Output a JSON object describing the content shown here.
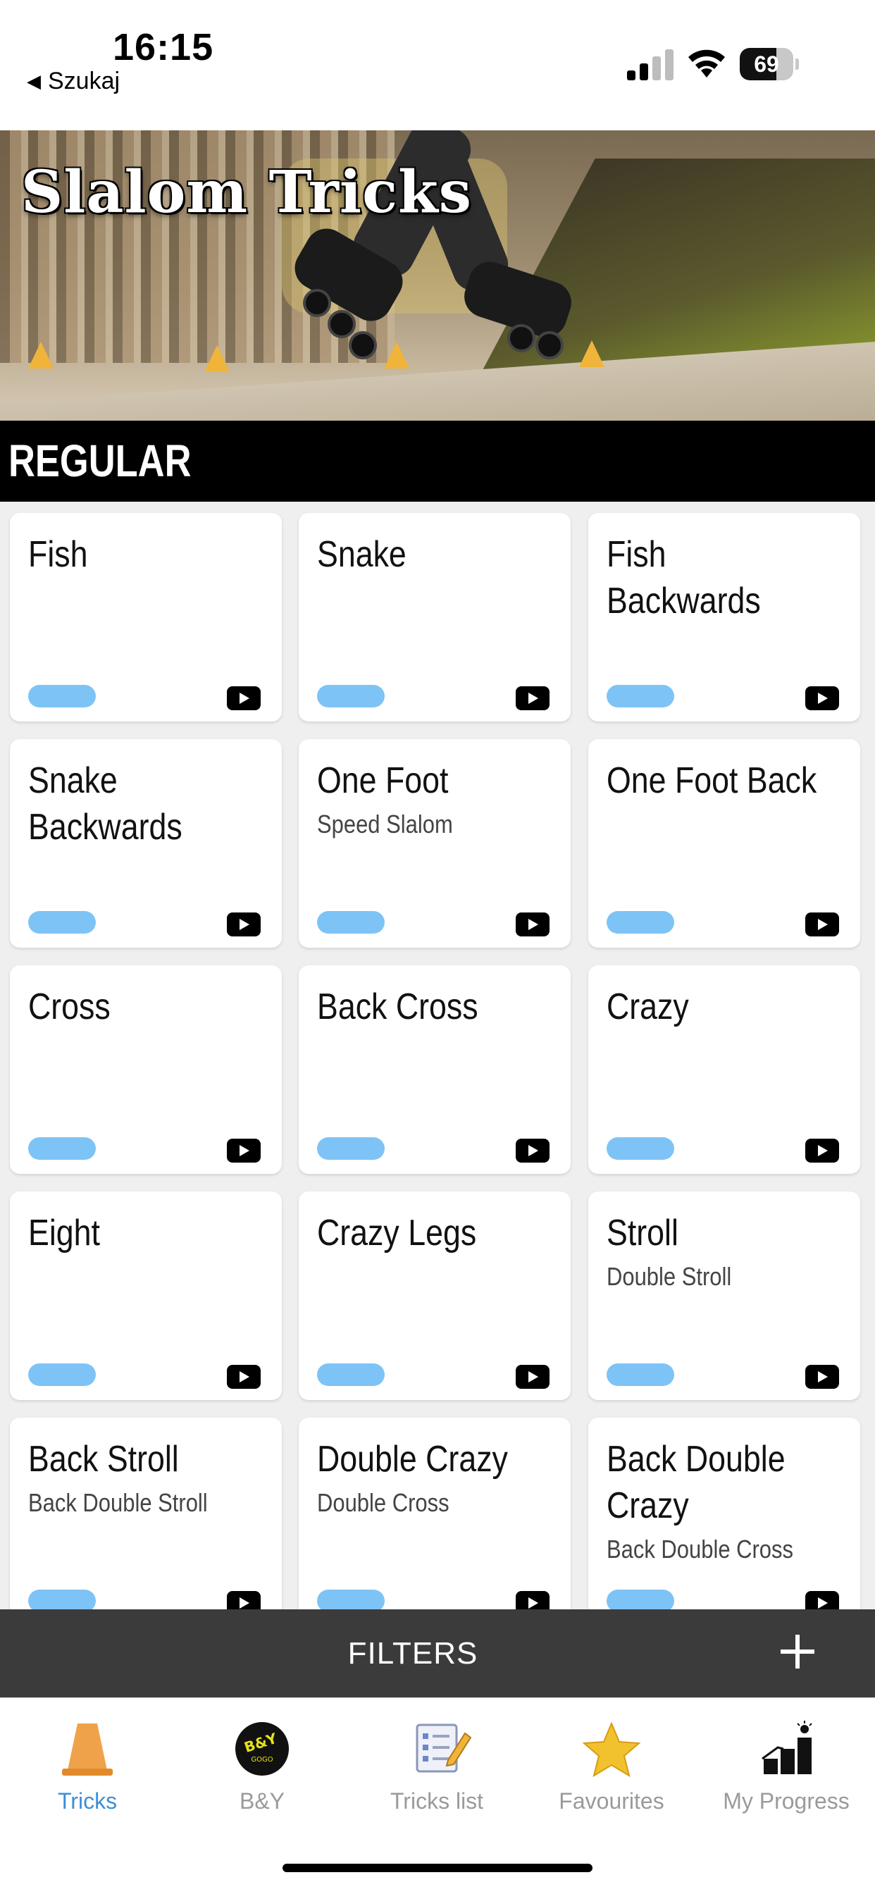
{
  "status_bar": {
    "time": "16:15",
    "back_label": "Szukaj",
    "battery_percent": "69",
    "battery_level": 0.69,
    "icons": [
      "signal-icon",
      "wifi-icon",
      "battery-icon"
    ]
  },
  "hero": {
    "title": "Slalom Tricks"
  },
  "section": {
    "title": "REGULAR"
  },
  "colors": {
    "progress": "#7ec3f5",
    "active_tab": "#3d8ed8",
    "inactive_tab": "#9a9a9a",
    "filters_bg": "#3b3b3b"
  },
  "tricks": [
    {
      "name": "Fish",
      "subtitle": ""
    },
    {
      "name": "Snake",
      "subtitle": ""
    },
    {
      "name": "Fish Backwards",
      "subtitle": ""
    },
    {
      "name": "Snake Backwards",
      "subtitle": ""
    },
    {
      "name": "One Foot",
      "subtitle": "Speed Slalom"
    },
    {
      "name": "One Foot Back",
      "subtitle": ""
    },
    {
      "name": "Cross",
      "subtitle": ""
    },
    {
      "name": "Back Cross",
      "subtitle": ""
    },
    {
      "name": "Crazy",
      "subtitle": ""
    },
    {
      "name": "Eight",
      "subtitle": ""
    },
    {
      "name": "Crazy Legs",
      "subtitle": ""
    },
    {
      "name": "Stroll",
      "subtitle": "Double Stroll"
    },
    {
      "name": "Back Stroll",
      "subtitle": "Back Double Stroll"
    },
    {
      "name": "Double Crazy",
      "subtitle": "Double Cross"
    },
    {
      "name": "Back Double Crazy",
      "subtitle": "Back Double Cross"
    }
  ],
  "filters": {
    "label": "FILTERS"
  },
  "tabs": [
    {
      "label": "Tricks",
      "icon": "cone-icon",
      "active": true
    },
    {
      "label": "B&Y",
      "icon": "by-logo-icon",
      "active": false
    },
    {
      "label": "Tricks list",
      "icon": "checklist-icon",
      "active": false
    },
    {
      "label": "Favourites",
      "icon": "star-icon",
      "active": false
    },
    {
      "label": "My Progress",
      "icon": "progress-steps-icon",
      "active": false
    }
  ]
}
